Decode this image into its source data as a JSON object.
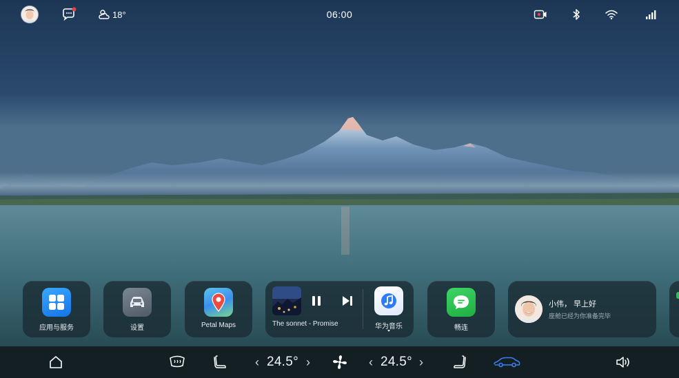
{
  "status_bar": {
    "time": "06:00",
    "weather": {
      "icon": "partly-cloudy-icon",
      "temperature": "18°"
    },
    "icons": [
      "avatar",
      "message-icon",
      "dashcam-icon",
      "bluetooth-icon",
      "wifi-icon",
      "signal-icon"
    ],
    "notification_dot_color": "#e8423b"
  },
  "dock": {
    "apps": [
      {
        "id": "apps-services",
        "label": "应用与服务",
        "icon": "app-grid-icon",
        "color": "#1e8ef5"
      },
      {
        "id": "settings",
        "label": "设置",
        "icon": "car-settings-icon",
        "color": "#5c6774"
      },
      {
        "id": "petal-maps",
        "label": "Petal Maps",
        "icon": "map-pin-icon",
        "color": "#3a8ff0"
      }
    ],
    "media": {
      "track": "The sonnet - Promise",
      "app_label": "华为音乐",
      "controls": [
        "pause-icon",
        "next-icon"
      ],
      "app_icon_color": "#2e7bf6"
    },
    "chat": {
      "label": "畅连",
      "icon": "chat-bubble-icon",
      "color": "#27c24c"
    },
    "greeting": {
      "title": "小伟， 早上好",
      "subtitle": "座舱已经为你准备完毕"
    }
  },
  "control_bar": {
    "driver_temp": "24.5°",
    "passenger_temp": "24.5°",
    "icons": [
      "home-icon",
      "rear-defrost-icon",
      "driver-seat-icon",
      "fan-icon",
      "passenger-seat-icon",
      "car-status-icon",
      "volume-icon"
    ],
    "accent_color": "#3d7df5"
  }
}
